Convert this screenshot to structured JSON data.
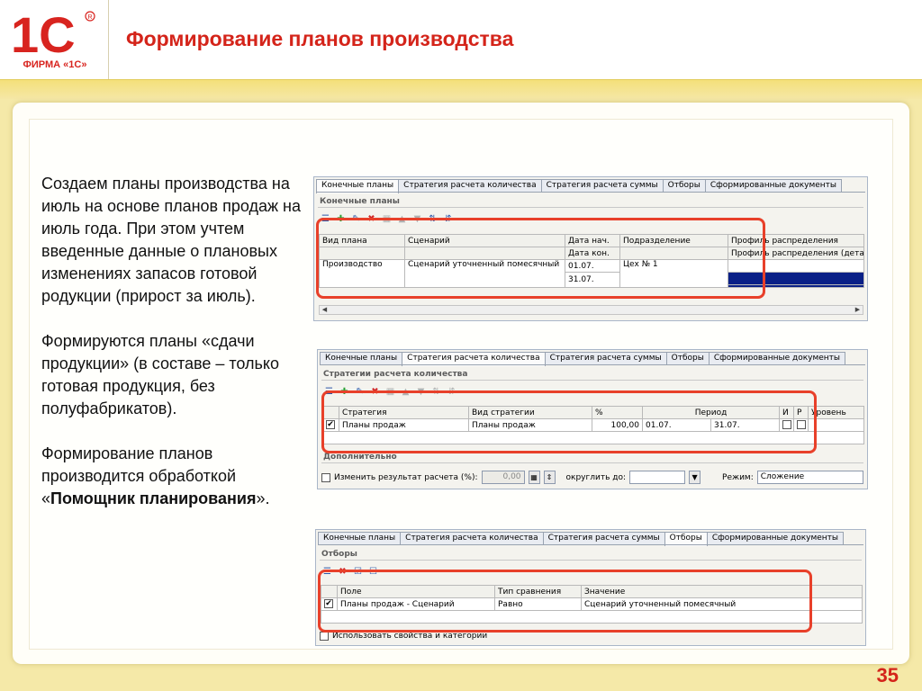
{
  "header": {
    "logo_mark": "1С",
    "logo_caption": "ФИРМА «1С»",
    "title": "Формирование планов производства"
  },
  "text": {
    "para1": "Создаем планы производства на июль на основе планов продаж на июль года. При этом учтем введенные данные о плановых изменениях запасов готовой родукции (прирост за июль).",
    "para2": "Формируются планы «сдачи продукции» (в составе – только готовая продукция, без полуфабрикатов).",
    "para3_before": "Формирование планов производится обработкой «",
    "para3_bold": "Помощник планирования",
    "para3_after": "»."
  },
  "tabs": [
    "Конечные планы",
    "Стратегия расчета количества",
    "Стратегия расчета суммы",
    "Отборы",
    "Сформированные документы"
  ],
  "win1": {
    "section": "Конечные планы",
    "headers": {
      "plan_type": "Вид плана",
      "scenario": "Сценарий",
      "date_start": "Дата нач.",
      "date_end": "Дата кон.",
      "division": "Подразделение",
      "profile": "Профиль распределения",
      "profile_detail": "Профиль распределения (дета"
    },
    "row": {
      "plan_type": "Производство",
      "scenario": "Сценарий уточненный помесячный",
      "date_start": "01.07.",
      "date_end": "31.07.",
      "division": "Цех № 1"
    }
  },
  "win2": {
    "section": "Стратегии расчета количества",
    "headers": {
      "strategy": "Стратегия",
      "strategy_type": "Вид стратегии",
      "percent": "%",
      "period": "Период",
      "i": "И",
      "r": "Р",
      "level": "Уровень"
    },
    "row": {
      "strategy": "Планы продаж",
      "strategy_type": "Планы продаж",
      "percent": "100,00",
      "period_start": "01.07.",
      "period_end": "31.07."
    },
    "extra_title": "Дополнительно",
    "change_label": "Изменить результат расчета (%):",
    "change_value": "0,00",
    "round_label": "округлить до:",
    "mode_label": "Режим:",
    "mode_value": "Сложение"
  },
  "win3": {
    "section": "Отборы",
    "headers": {
      "field": "Поле",
      "comparison": "Тип сравнения",
      "value": "Значение"
    },
    "row": {
      "field": "Планы продаж - Сценарий",
      "comparison": "Равно",
      "value": "Сценарий уточненный помесячный"
    },
    "use_props_label": "Использовать свойства и категории"
  },
  "page_number": "35",
  "colors": {
    "accent_red": "#d4241a",
    "highlight": "#e8402a",
    "background": "#f5e9a8",
    "selection": "#0a2087"
  }
}
